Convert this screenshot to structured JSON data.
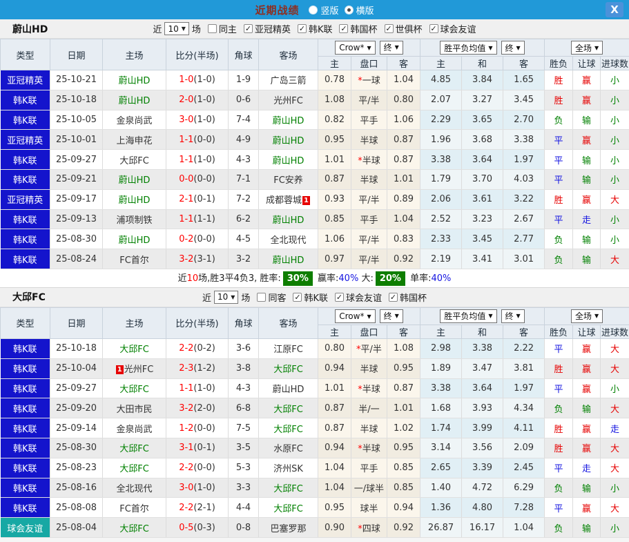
{
  "titlebar": {
    "title": "近期战绩",
    "radios": [
      {
        "label": "竖版",
        "checked": false
      },
      {
        "label": "横版",
        "checked": true
      }
    ],
    "close_label": "X"
  },
  "table_header": {
    "static_cols": [
      "类型",
      "日期",
      "主场",
      "比分(半场)",
      "角球",
      "客场"
    ],
    "group1": {
      "dropdown1": "Crow*",
      "dropdown2": "终",
      "subs": [
        "主",
        "盘口",
        "客"
      ]
    },
    "group2": {
      "dropdown1": "胜平负均值",
      "dropdown2": "终",
      "subs": [
        "主",
        "和",
        "客"
      ]
    },
    "group3": {
      "dropdown": "全场",
      "subs": [
        "胜负",
        "让球",
        "进球数"
      ]
    }
  },
  "colors": {
    "league_bg": {
      "亚冠精英": "#1414cc",
      "韩K联": "#1414cc",
      "球会友谊": "#17a8a4"
    },
    "result": {
      "胜": "#e60000",
      "平": "#1414e0",
      "负": "#008000"
    },
    "line_result": {
      "赢": "#e60000",
      "走": "#1414e0",
      "输": "#008000"
    },
    "goals": {
      "大": "#e60000",
      "小": "#008000",
      "走": "#1414e0"
    }
  },
  "sections": [
    {
      "team": "蔚山HD",
      "filter": {
        "prefix": "近",
        "count": "10",
        "suffix": "场",
        "same": {
          "label": "同主",
          "checked": false
        },
        "leagues": [
          {
            "label": "亚冠精英",
            "checked": true
          },
          {
            "label": "韩K联",
            "checked": true
          },
          {
            "label": "韩国杯",
            "checked": true
          },
          {
            "label": "世俱杯",
            "checked": true
          },
          {
            "label": "球会友谊",
            "checked": true
          }
        ]
      },
      "rows": [
        {
          "league": "亚冠精英",
          "date": "25-10-21",
          "home": "蔚山HD",
          "homeGreen": true,
          "score": "1-0",
          "half": "(1-0)",
          "corners": "1-9",
          "away": "广岛三箭",
          "awayGreen": false,
          "crowHome": "0.78",
          "line": "一球",
          "lineStar": true,
          "crowAway": "1.04",
          "avgHome": "4.85",
          "avgDraw": "3.84",
          "avgAway": "1.65",
          "result": "胜",
          "lineResult": "赢",
          "goals": "小"
        },
        {
          "league": "韩K联",
          "date": "25-10-18",
          "home": "蔚山HD",
          "homeGreen": true,
          "score": "2-0",
          "half": "(1-0)",
          "corners": "0-6",
          "away": "光州FC",
          "awayGreen": false,
          "crowHome": "1.08",
          "line": "平/半",
          "lineStar": false,
          "crowAway": "0.80",
          "avgHome": "2.07",
          "avgDraw": "3.27",
          "avgAway": "3.45",
          "result": "胜",
          "lineResult": "赢",
          "goals": "小"
        },
        {
          "league": "韩K联",
          "date": "25-10-05",
          "home": "金泉尚武",
          "homeGreen": false,
          "score": "3-0",
          "half": "(1-0)",
          "corners": "7-4",
          "away": "蔚山HD",
          "awayGreen": true,
          "crowHome": "0.82",
          "line": "平手",
          "lineStar": false,
          "crowAway": "1.06",
          "avgHome": "2.29",
          "avgDraw": "3.65",
          "avgAway": "2.70",
          "result": "负",
          "lineResult": "输",
          "goals": "小"
        },
        {
          "league": "亚冠精英",
          "date": "25-10-01",
          "home": "上海申花",
          "homeGreen": false,
          "score": "1-1",
          "half": "(0-0)",
          "corners": "4-9",
          "away": "蔚山HD",
          "awayGreen": true,
          "crowHome": "0.95",
          "line": "半球",
          "lineStar": false,
          "crowAway": "0.87",
          "avgHome": "1.96",
          "avgDraw": "3.68",
          "avgAway": "3.38",
          "result": "平",
          "lineResult": "赢",
          "goals": "小"
        },
        {
          "league": "韩K联",
          "date": "25-09-27",
          "home": "大邱FC",
          "homeGreen": false,
          "score": "1-1",
          "half": "(1-0)",
          "corners": "4-3",
          "away": "蔚山HD",
          "awayGreen": true,
          "crowHome": "1.01",
          "line": "半球",
          "lineStar": true,
          "crowAway": "0.87",
          "avgHome": "3.38",
          "avgDraw": "3.64",
          "avgAway": "1.97",
          "result": "平",
          "lineResult": "输",
          "goals": "小"
        },
        {
          "league": "韩K联",
          "date": "25-09-21",
          "home": "蔚山HD",
          "homeGreen": true,
          "score": "0-0",
          "half": "(0-0)",
          "corners": "7-1",
          "away": "FC安养",
          "awayGreen": false,
          "crowHome": "0.87",
          "line": "半球",
          "lineStar": false,
          "crowAway": "1.01",
          "avgHome": "1.79",
          "avgDraw": "3.70",
          "avgAway": "4.03",
          "result": "平",
          "lineResult": "输",
          "goals": "小"
        },
        {
          "league": "亚冠精英",
          "date": "25-09-17",
          "home": "蔚山HD",
          "homeGreen": true,
          "score": "2-1",
          "half": "(0-1)",
          "corners": "7-2",
          "away": "成都蓉城",
          "awayGreen": false,
          "awayBadge": {
            "text": "1",
            "pos": "after"
          },
          "crowHome": "0.93",
          "line": "平/半",
          "lineStar": false,
          "crowAway": "0.89",
          "avgHome": "2.06",
          "avgDraw": "3.61",
          "avgAway": "3.22",
          "result": "胜",
          "lineResult": "赢",
          "goals": "大"
        },
        {
          "league": "韩K联",
          "date": "25-09-13",
          "home": "浦项制铁",
          "homeGreen": false,
          "score": "1-1",
          "half": "(1-1)",
          "corners": "6-2",
          "away": "蔚山HD",
          "awayGreen": true,
          "crowHome": "0.85",
          "line": "平手",
          "lineStar": false,
          "crowAway": "1.04",
          "avgHome": "2.52",
          "avgDraw": "3.23",
          "avgAway": "2.67",
          "result": "平",
          "lineResult": "走",
          "goals": "小"
        },
        {
          "league": "韩K联",
          "date": "25-08-30",
          "home": "蔚山HD",
          "homeGreen": true,
          "score": "0-2",
          "half": "(0-0)",
          "corners": "4-5",
          "away": "全北现代",
          "awayGreen": false,
          "crowHome": "1.06",
          "line": "平/半",
          "lineStar": false,
          "crowAway": "0.83",
          "avgHome": "2.33",
          "avgDraw": "3.45",
          "avgAway": "2.77",
          "result": "负",
          "lineResult": "输",
          "goals": "小"
        },
        {
          "league": "韩K联",
          "date": "25-08-24",
          "home": "FC首尔",
          "homeGreen": false,
          "score": "3-2",
          "half": "(3-1)",
          "corners": "3-2",
          "away": "蔚山HD",
          "awayGreen": true,
          "crowHome": "0.97",
          "line": "平/半",
          "lineStar": false,
          "crowAway": "0.92",
          "avgHome": "2.19",
          "avgDraw": "3.41",
          "avgAway": "3.01",
          "result": "负",
          "lineResult": "输",
          "goals": "大"
        }
      ],
      "summary": [
        {
          "text": "近",
          "style": "plain"
        },
        {
          "text": "10",
          "style": "red"
        },
        {
          "text": "场,胜3平4负3, 胜率:",
          "style": "plain"
        },
        {
          "text": "30%",
          "style": "greenbadge"
        },
        {
          "text": " 赢率:",
          "style": "plain"
        },
        {
          "text": "40%",
          "style": "blue"
        },
        {
          "text": " 大:",
          "style": "plain"
        },
        {
          "text": "20%",
          "style": "greenbadge"
        },
        {
          "text": " 单率:",
          "style": "plain"
        },
        {
          "text": "40%",
          "style": "blue"
        }
      ]
    },
    {
      "team": "大邱FC",
      "filter": {
        "prefix": "近",
        "count": "10",
        "suffix": "场",
        "same": {
          "label": "同客",
          "checked": false
        },
        "leagues": [
          {
            "label": "韩K联",
            "checked": true
          },
          {
            "label": "球会友谊",
            "checked": true
          },
          {
            "label": "韩国杯",
            "checked": true
          }
        ]
      },
      "rows": [
        {
          "league": "韩K联",
          "date": "25-10-18",
          "home": "大邱FC",
          "homeGreen": true,
          "score": "2-2",
          "half": "(0-2)",
          "corners": "3-6",
          "away": "江原FC",
          "awayGreen": false,
          "crowHome": "0.80",
          "line": "平/半",
          "lineStar": true,
          "crowAway": "1.08",
          "avgHome": "2.98",
          "avgDraw": "3.38",
          "avgAway": "2.22",
          "result": "平",
          "lineResult": "赢",
          "goals": "大"
        },
        {
          "league": "韩K联",
          "date": "25-10-04",
          "home": "光州FC",
          "homeGreen": false,
          "homeBadge": {
            "text": "1",
            "pos": "before"
          },
          "score": "2-3",
          "half": "(1-2)",
          "corners": "3-8",
          "away": "大邱FC",
          "awayGreen": true,
          "crowHome": "0.94",
          "line": "半球",
          "lineStar": false,
          "crowAway": "0.95",
          "avgHome": "1.89",
          "avgDraw": "3.47",
          "avgAway": "3.81",
          "result": "胜",
          "lineResult": "赢",
          "goals": "大"
        },
        {
          "league": "韩K联",
          "date": "25-09-27",
          "home": "大邱FC",
          "homeGreen": true,
          "score": "1-1",
          "half": "(1-0)",
          "corners": "4-3",
          "away": "蔚山HD",
          "awayGreen": false,
          "crowHome": "1.01",
          "line": "半球",
          "lineStar": true,
          "crowAway": "0.87",
          "avgHome": "3.38",
          "avgDraw": "3.64",
          "avgAway": "1.97",
          "result": "平",
          "lineResult": "赢",
          "goals": "小"
        },
        {
          "league": "韩K联",
          "date": "25-09-20",
          "home": "大田市民",
          "homeGreen": false,
          "score": "3-2",
          "half": "(2-0)",
          "corners": "6-8",
          "away": "大邱FC",
          "awayGreen": true,
          "crowHome": "0.87",
          "line": "半/一",
          "lineStar": false,
          "crowAway": "1.01",
          "avgHome": "1.68",
          "avgDraw": "3.93",
          "avgAway": "4.34",
          "result": "负",
          "lineResult": "输",
          "goals": "大"
        },
        {
          "league": "韩K联",
          "date": "25-09-14",
          "home": "金泉尚武",
          "homeGreen": false,
          "score": "1-2",
          "half": "(0-0)",
          "corners": "7-5",
          "away": "大邱FC",
          "awayGreen": true,
          "crowHome": "0.87",
          "line": "半球",
          "lineStar": false,
          "crowAway": "1.02",
          "avgHome": "1.74",
          "avgDraw": "3.99",
          "avgAway": "4.11",
          "result": "胜",
          "lineResult": "赢",
          "goals": "走"
        },
        {
          "league": "韩K联",
          "date": "25-08-30",
          "home": "大邱FC",
          "homeGreen": true,
          "score": "3-1",
          "half": "(0-1)",
          "corners": "3-5",
          "away": "水原FC",
          "awayGreen": false,
          "crowHome": "0.94",
          "line": "半球",
          "lineStar": true,
          "crowAway": "0.95",
          "avgHome": "3.14",
          "avgDraw": "3.56",
          "avgAway": "2.09",
          "result": "胜",
          "lineResult": "赢",
          "goals": "大"
        },
        {
          "league": "韩K联",
          "date": "25-08-23",
          "home": "大邱FC",
          "homeGreen": true,
          "score": "2-2",
          "half": "(0-0)",
          "corners": "5-3",
          "away": "济州SK",
          "awayGreen": false,
          "crowHome": "1.04",
          "line": "平手",
          "lineStar": false,
          "crowAway": "0.85",
          "avgHome": "2.65",
          "avgDraw": "3.39",
          "avgAway": "2.45",
          "result": "平",
          "lineResult": "走",
          "goals": "大"
        },
        {
          "league": "韩K联",
          "date": "25-08-16",
          "home": "全北现代",
          "homeGreen": false,
          "score": "3-0",
          "half": "(1-0)",
          "corners": "3-3",
          "away": "大邱FC",
          "awayGreen": true,
          "crowHome": "1.04",
          "line": "一/球半",
          "lineStar": false,
          "crowAway": "0.85",
          "avgHome": "1.40",
          "avgDraw": "4.72",
          "avgAway": "6.29",
          "result": "负",
          "lineResult": "输",
          "goals": "小"
        },
        {
          "league": "韩K联",
          "date": "25-08-08",
          "home": "FC首尔",
          "homeGreen": false,
          "score": "2-2",
          "half": "(2-1)",
          "corners": "4-4",
          "away": "大邱FC",
          "awayGreen": true,
          "crowHome": "0.95",
          "line": "球半",
          "lineStar": false,
          "crowAway": "0.94",
          "avgHome": "1.36",
          "avgDraw": "4.80",
          "avgAway": "7.28",
          "result": "平",
          "lineResult": "赢",
          "goals": "大"
        },
        {
          "league": "球会友谊",
          "date": "25-08-04",
          "home": "大邱FC",
          "homeGreen": true,
          "score": "0-5",
          "half": "(0-3)",
          "corners": "0-8",
          "away": "巴塞罗那",
          "awayGreen": false,
          "crowHome": "0.90",
          "line": "四球",
          "lineStar": true,
          "crowAway": "0.92",
          "avgHome": "26.87",
          "avgDraw": "16.17",
          "avgAway": "1.04",
          "result": "负",
          "lineResult": "输",
          "goals": "小"
        }
      ],
      "summary": null
    }
  ]
}
